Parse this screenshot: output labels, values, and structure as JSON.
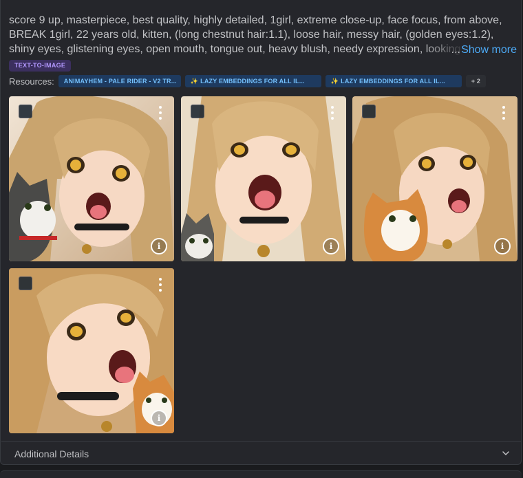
{
  "prompt": {
    "text": "score 9 up, masterpiece, best quality, highly detailed, 1girl, extreme close-up, face focus, from above, BREAK 1girl, 22 years old, kitten, (long chestnut hair:1.1), loose hair, messy hair, (golden eyes:1.2), shiny eyes, glistening eyes, open mouth, tongue out, heavy blush, needy expression, looking up,",
    "ellipsis": "...",
    "show_more": "Show more"
  },
  "badge": "TEXT-TO-IMAGE",
  "resources": {
    "label": "Resources:",
    "chips": [
      {
        "label": "ANIMAYHEM - PALE RIDER - V2 TR..."
      },
      {
        "label": "LAZY EMBEDDINGS FOR ALL IL..."
      },
      {
        "label": "LAZY EMBEDDINGS FOR ALL IL..."
      }
    ],
    "more": "+ 2"
  },
  "images": [
    {
      "cat": "gray-white-cat"
    },
    {
      "cat": "gray-white-cat"
    },
    {
      "cat": "orange-white-cat"
    },
    {
      "cat": "orange-white-cat"
    }
  ],
  "footer": {
    "additional_details": "Additional Details"
  },
  "colors": {
    "accent_link": "#4dabf7",
    "badge_bg": "#3b2f5e",
    "chip_bg": "#1e3a5f"
  }
}
